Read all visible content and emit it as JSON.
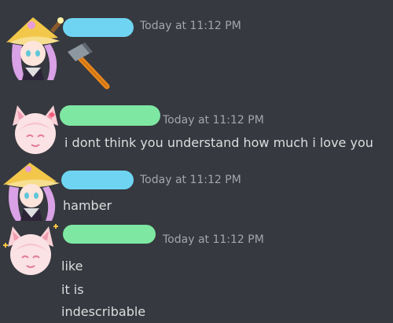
{
  "channel_messages": [
    {
      "author_redacted_color": "#6fd4f2",
      "avatar_icon": "witch-girl-avatar-icon",
      "timestamp": "Today at 11:12 PM",
      "attachment_icon": "hammer-emoji-icon",
      "lines": []
    },
    {
      "author_redacted_color": "#7ee8a3",
      "avatar_icon": "pink-cat-girl-avatar-icon",
      "timestamp": "Today at 11:12 PM",
      "lines": [
        "i dont think you understand how much i love you"
      ]
    },
    {
      "author_redacted_color": "#6fd4f2",
      "avatar_icon": "witch-girl-avatar-icon",
      "timestamp": "Today at 11:12 PM",
      "lines": [
        "hamber"
      ]
    },
    {
      "author_redacted_color": "#7ee8a3",
      "avatar_icon": "pink-cat-girl-avatar-icon",
      "timestamp": "Today at 11:12 PM",
      "lines": [
        "like",
        "it is",
        "indescribable"
      ]
    }
  ],
  "theme": {
    "background": "#36393f",
    "text": "#dcddde",
    "timestamp": "#a3a6aa"
  }
}
